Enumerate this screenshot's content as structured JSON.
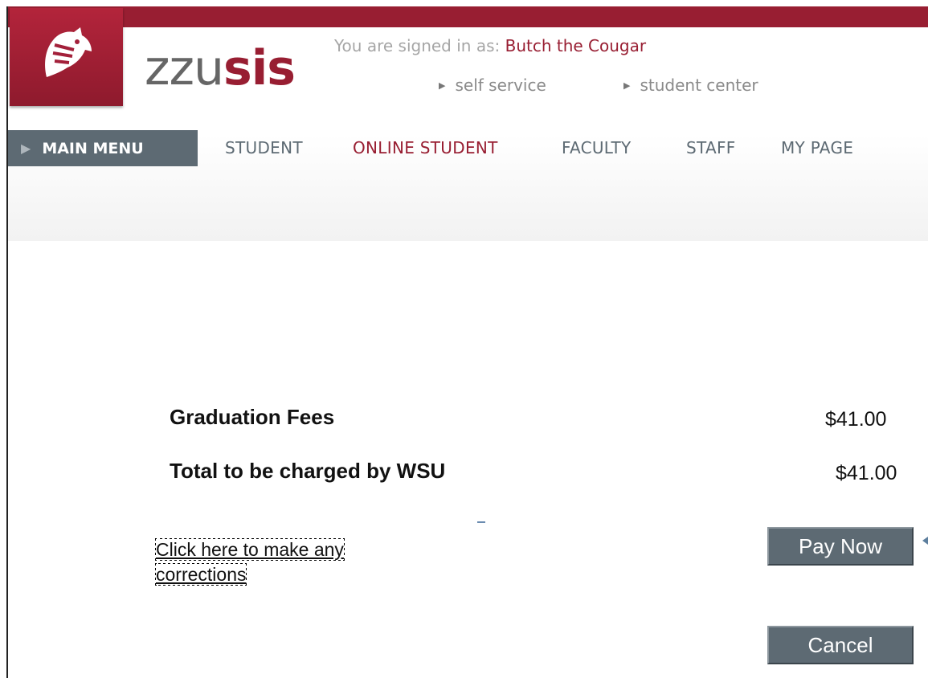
{
  "header": {
    "brand_prefix": "ZZU",
    "brand_suffix": "SIS",
    "signed_in_label": "You are signed in as:",
    "user_name": "Butch the Cougar",
    "links": [
      "self service",
      "student center"
    ]
  },
  "nav": {
    "main_menu": "MAIN MENU",
    "items": [
      "STUDENT",
      "ONLINE STUDENT",
      "FACULTY",
      "STAFF",
      "MY PAGE"
    ],
    "active_item": "ONLINE STUDENT"
  },
  "fees": [
    {
      "label": "Graduation Fees",
      "amount": "$41.00"
    },
    {
      "label": "Total to be charged by WSU",
      "amount": "$41.00"
    }
  ],
  "corrections_link": "Click here to make any corrections",
  "buttons": {
    "pay_now": "Pay Now",
    "cancel": "Cancel"
  },
  "colors": {
    "brand": "#981e32",
    "button": "#5d6a73"
  },
  "icons": {
    "logo": "cougar-head-logo-icon"
  }
}
